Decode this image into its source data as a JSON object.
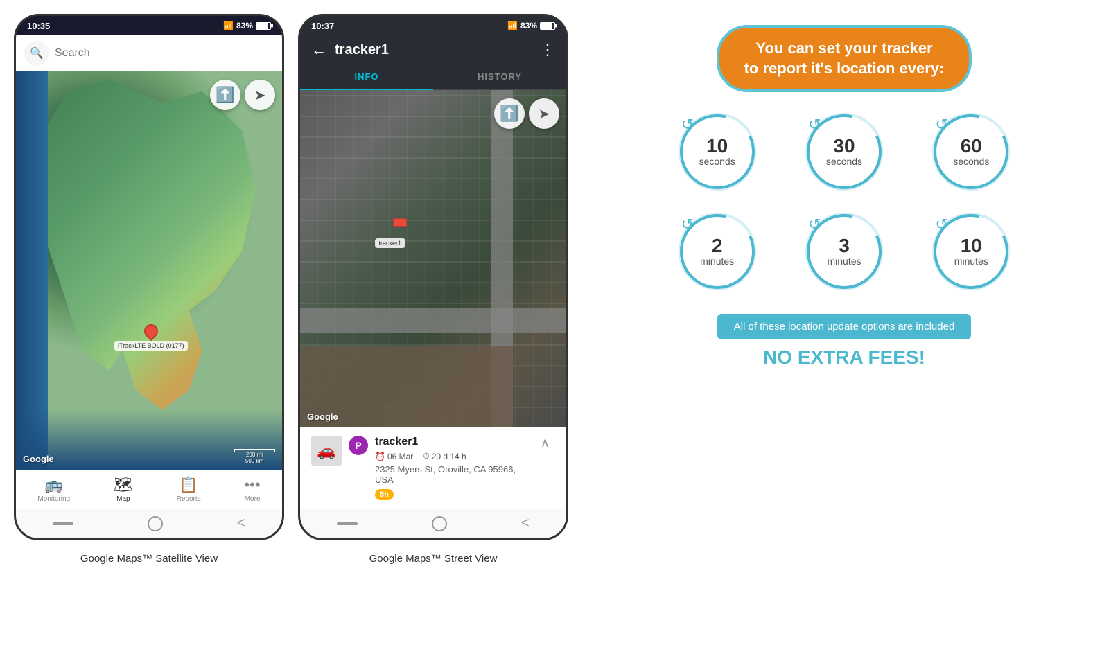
{
  "phone1": {
    "status_time": "10:35",
    "status_battery": "83%",
    "search_placeholder": "Search",
    "google_label": "Google",
    "scale_text1": "200 mi",
    "scale_text2": "500 km",
    "tracker_pin_label": "iTrackLTE BOLD (0177)",
    "caption": "Google Maps™ Satellite View",
    "nav_items": [
      {
        "label": "Monitoring",
        "icon": "🚌"
      },
      {
        "label": "Map",
        "icon": "🗺"
      },
      {
        "label": "Reports",
        "icon": "📋"
      },
      {
        "label": "More",
        "icon": "•••"
      }
    ]
  },
  "phone2": {
    "status_time": "10:37",
    "status_battery": "83%",
    "title": "tracker1",
    "back_icon": "←",
    "more_icon": "⋮",
    "tab_info": "INFO",
    "tab_history": "HISTORY",
    "google_label": "Google",
    "tracker_label": "tracker1",
    "info_panel": {
      "tracker_name": "tracker1",
      "date": "06 Mar",
      "duration": "20 d 14 h",
      "address": "2325 Myers St, Oroville, CA 95966, USA",
      "badge": "5h"
    },
    "caption": "Google Maps™ Street View"
  },
  "infographic": {
    "headline": "You can set your tracker\nto report it's location every:",
    "intervals": [
      {
        "number": "10",
        "unit": "seconds"
      },
      {
        "number": "30",
        "unit": "seconds"
      },
      {
        "number": "60",
        "unit": "seconds"
      },
      {
        "number": "2",
        "unit": "minutes"
      },
      {
        "number": "3",
        "unit": "minutes"
      },
      {
        "number": "10",
        "unit": "minutes"
      }
    ],
    "included_text": "All of these location update options are included",
    "no_extra": "NO EXTRA FEES!"
  }
}
